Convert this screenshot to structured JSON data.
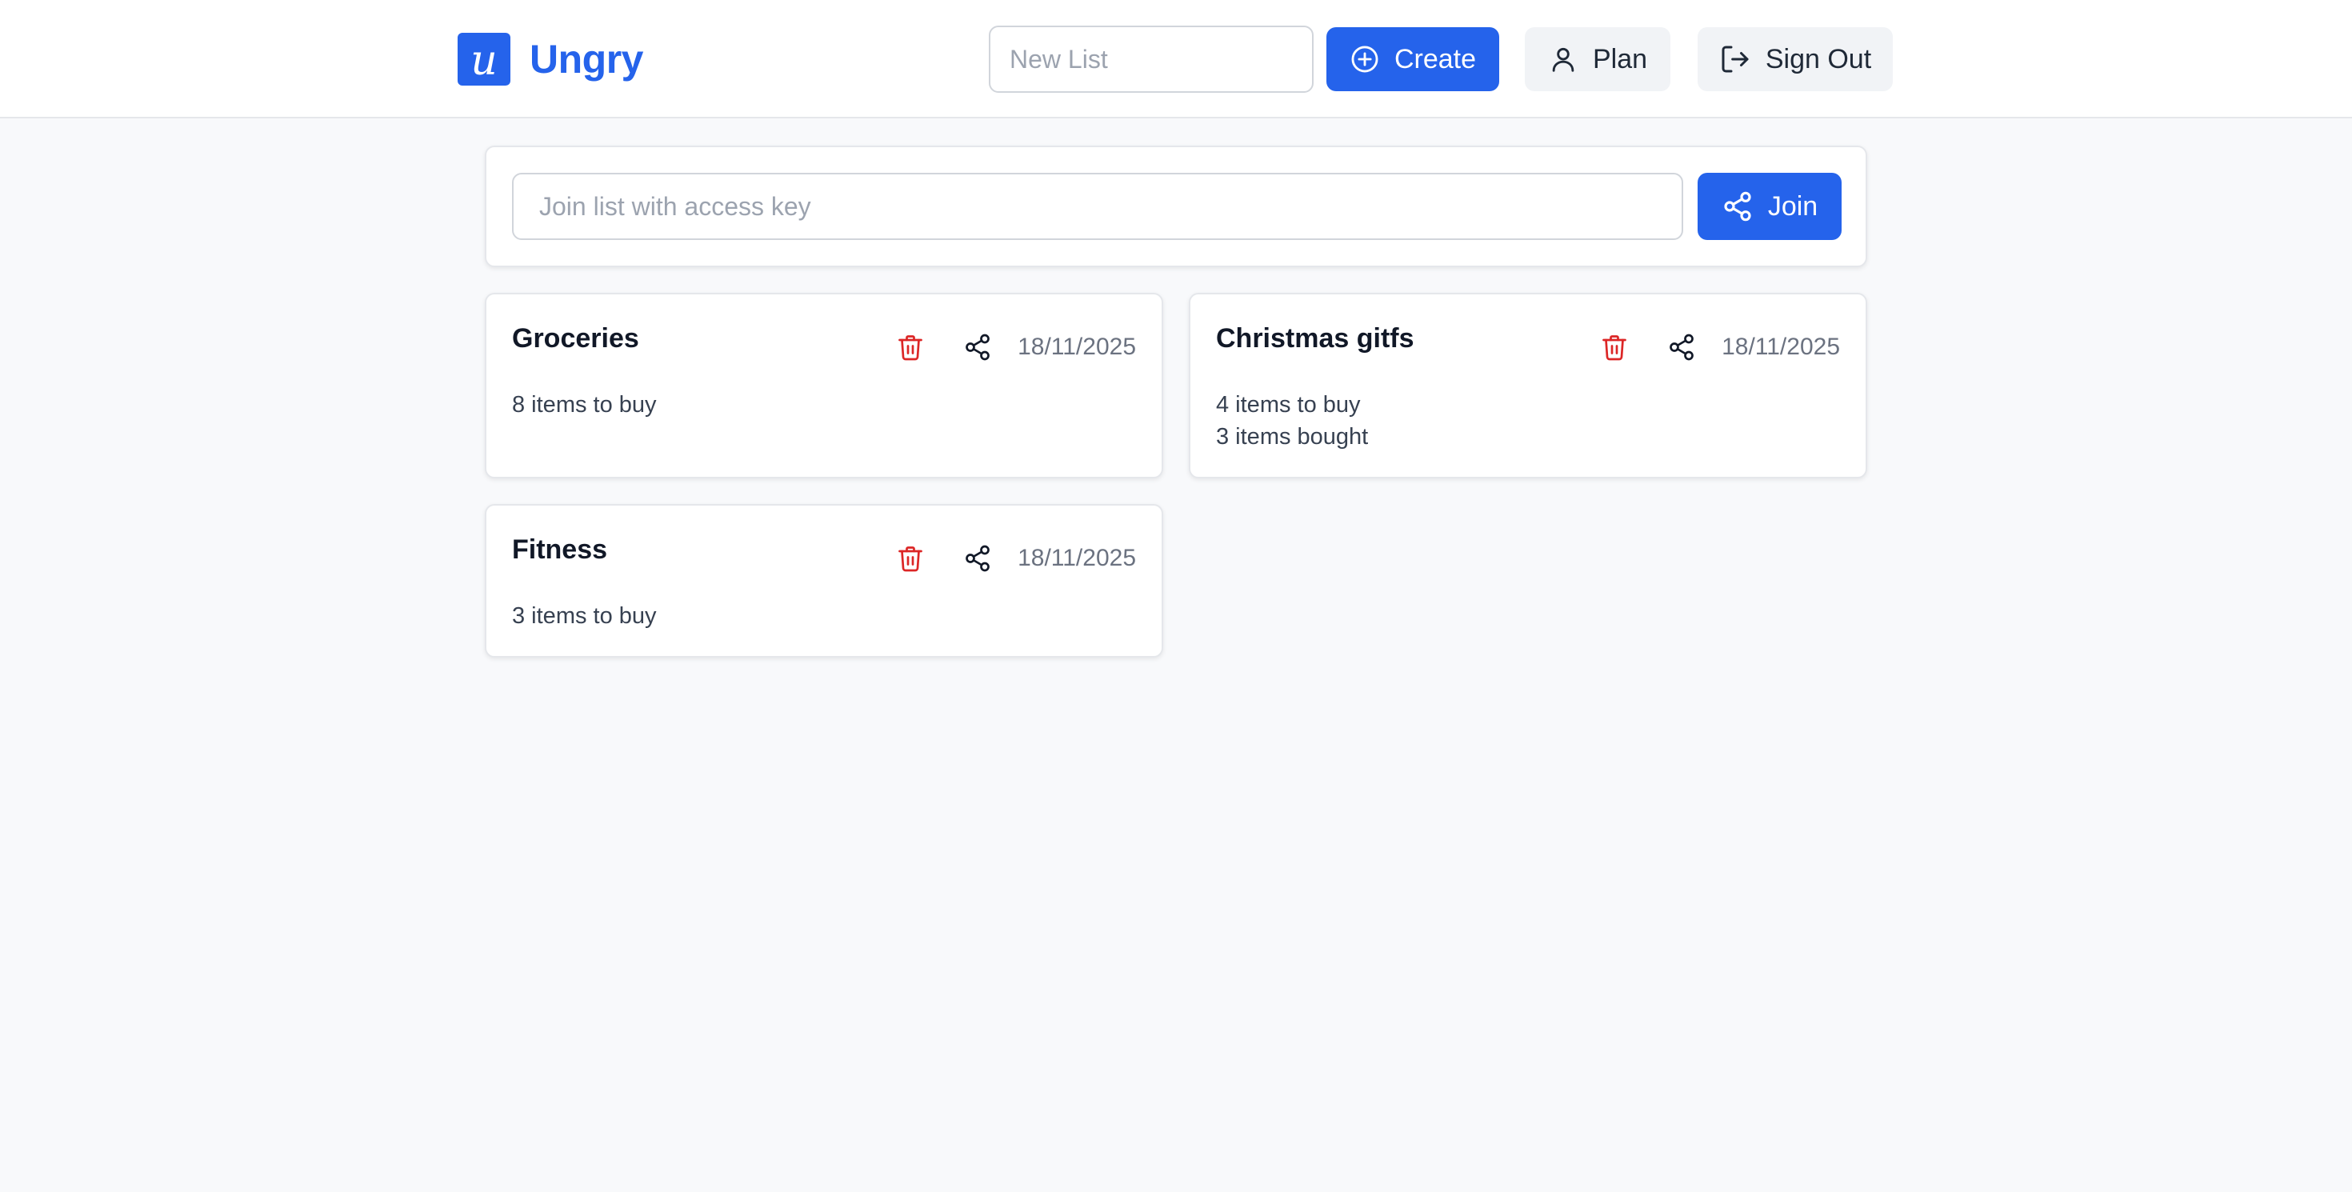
{
  "header": {
    "app_name": "Ungry",
    "logo_letter": "u",
    "new_list": {
      "value": "",
      "placeholder": "New List"
    },
    "create_label": "Create",
    "plan_label": "Plan",
    "sign_out_label": "Sign Out"
  },
  "join": {
    "placeholder": "Join list with access key",
    "value": "",
    "button_label": "Join"
  },
  "lists": [
    {
      "title": "Groceries",
      "date": "18/11/2025",
      "lines": [
        "8 items to buy"
      ]
    },
    {
      "title": "Christmas gitfs",
      "date": "18/11/2025",
      "lines": [
        "4 items to buy",
        "3 items bought"
      ]
    },
    {
      "title": "Fitness",
      "date": "18/11/2025",
      "lines": [
        "3 items to buy"
      ]
    }
  ],
  "icons": {
    "create": "plus-circle-icon",
    "plan": "user-icon",
    "sign_out": "logout-icon",
    "join": "share-icon",
    "delete": "trash-icon",
    "share": "share-icon"
  },
  "colors": {
    "primary": "#2563eb",
    "danger": "#dc2626",
    "background": "#f8f9fb",
    "secondary_button": "#f1f3f6"
  }
}
